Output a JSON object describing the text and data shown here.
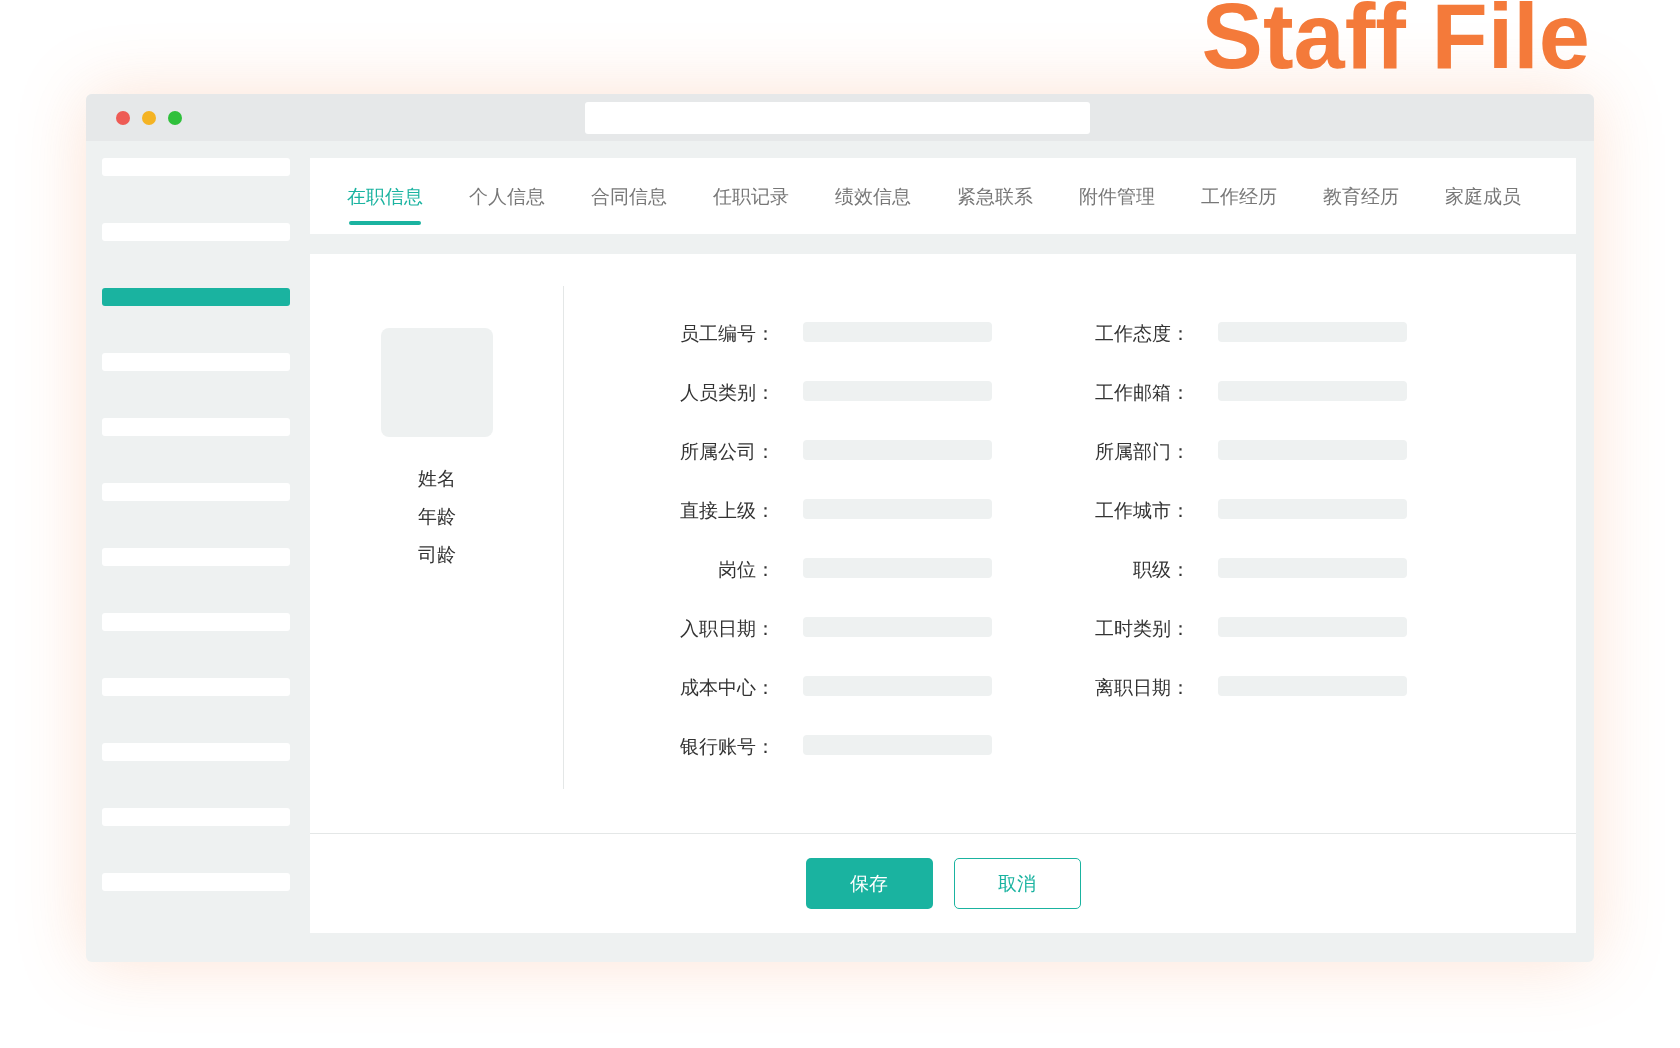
{
  "heading": "Staff File",
  "window": {
    "controls": [
      {
        "color": "#ee5b55"
      },
      {
        "color": "#f4b323"
      },
      {
        "color": "#2fc03b"
      }
    ]
  },
  "sidebar": {
    "items": [
      {
        "selected": false
      },
      {
        "selected": false
      },
      {
        "selected": true
      },
      {
        "selected": false
      },
      {
        "selected": false
      },
      {
        "selected": false
      },
      {
        "selected": false
      },
      {
        "selected": false
      },
      {
        "selected": false
      },
      {
        "selected": false
      },
      {
        "selected": false
      },
      {
        "selected": false
      }
    ]
  },
  "tabs": [
    {
      "label": "在职信息",
      "selected": true
    },
    {
      "label": "个人信息",
      "selected": false
    },
    {
      "label": "合同信息",
      "selected": false
    },
    {
      "label": "任职记录",
      "selected": false
    },
    {
      "label": "绩效信息",
      "selected": false
    },
    {
      "label": "紧急联系",
      "selected": false
    },
    {
      "label": "附件管理",
      "selected": false
    },
    {
      "label": "工作经历",
      "selected": false
    },
    {
      "label": "教育经历",
      "selected": false
    },
    {
      "label": "家庭成员",
      "selected": false
    }
  ],
  "profile": {
    "lines": [
      "姓名",
      "年龄",
      "司龄"
    ]
  },
  "fields": [
    {
      "label": "员工编号："
    },
    {
      "label": "工作态度："
    },
    {
      "label": "人员类别："
    },
    {
      "label": "工作邮箱："
    },
    {
      "label": "所属公司："
    },
    {
      "label": "所属部门："
    },
    {
      "label": "直接上级："
    },
    {
      "label": "工作城市："
    },
    {
      "label": "岗位："
    },
    {
      "label": "职级："
    },
    {
      "label": "入职日期："
    },
    {
      "label": "工时类别："
    },
    {
      "label": "成本中心："
    },
    {
      "label": "离职日期："
    },
    {
      "label": "银行账号："
    }
  ],
  "buttons": [
    {
      "label": "保存",
      "kind": "primary"
    },
    {
      "label": "取消",
      "kind": "outline"
    }
  ]
}
